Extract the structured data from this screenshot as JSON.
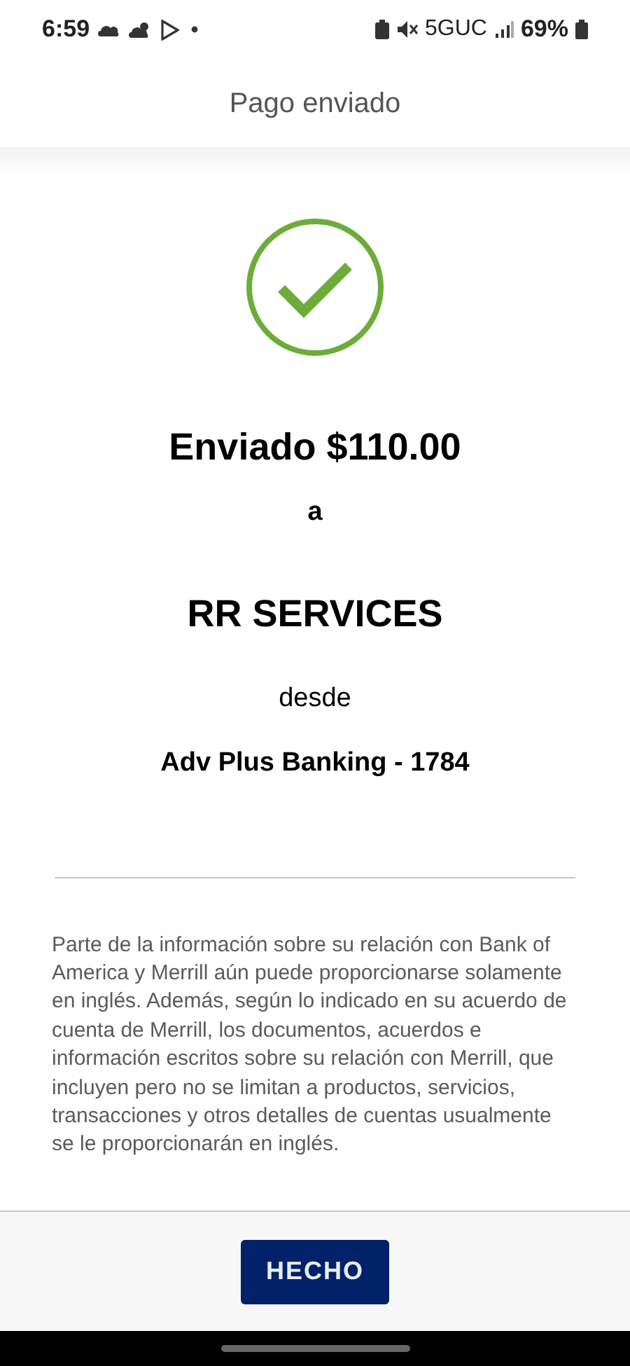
{
  "status_bar": {
    "time": "6:59",
    "network": "5GUC",
    "battery": "69%"
  },
  "header": {
    "title": "Pago enviado"
  },
  "confirmation": {
    "amount_line": "Enviado $110.00",
    "to_word": "a",
    "payee": "RR SERVICES",
    "from_word": "desde",
    "account": "Adv Plus Banking - 1784"
  },
  "disclaimer": "Parte de la información sobre su relación con Bank of America y Merrill aún puede proporcionarse solamente en inglés. Además, según lo indicado en su acuerdo de cuenta de Merrill, los documentos, acuerdos e información escritos sobre su relación con Merrill, que incluyen pero no se limitan a productos, servicios, transacciones y otros detalles de cuentas usualmente se le proporcionarán en inglés.",
  "footer": {
    "button": "HECHO"
  }
}
